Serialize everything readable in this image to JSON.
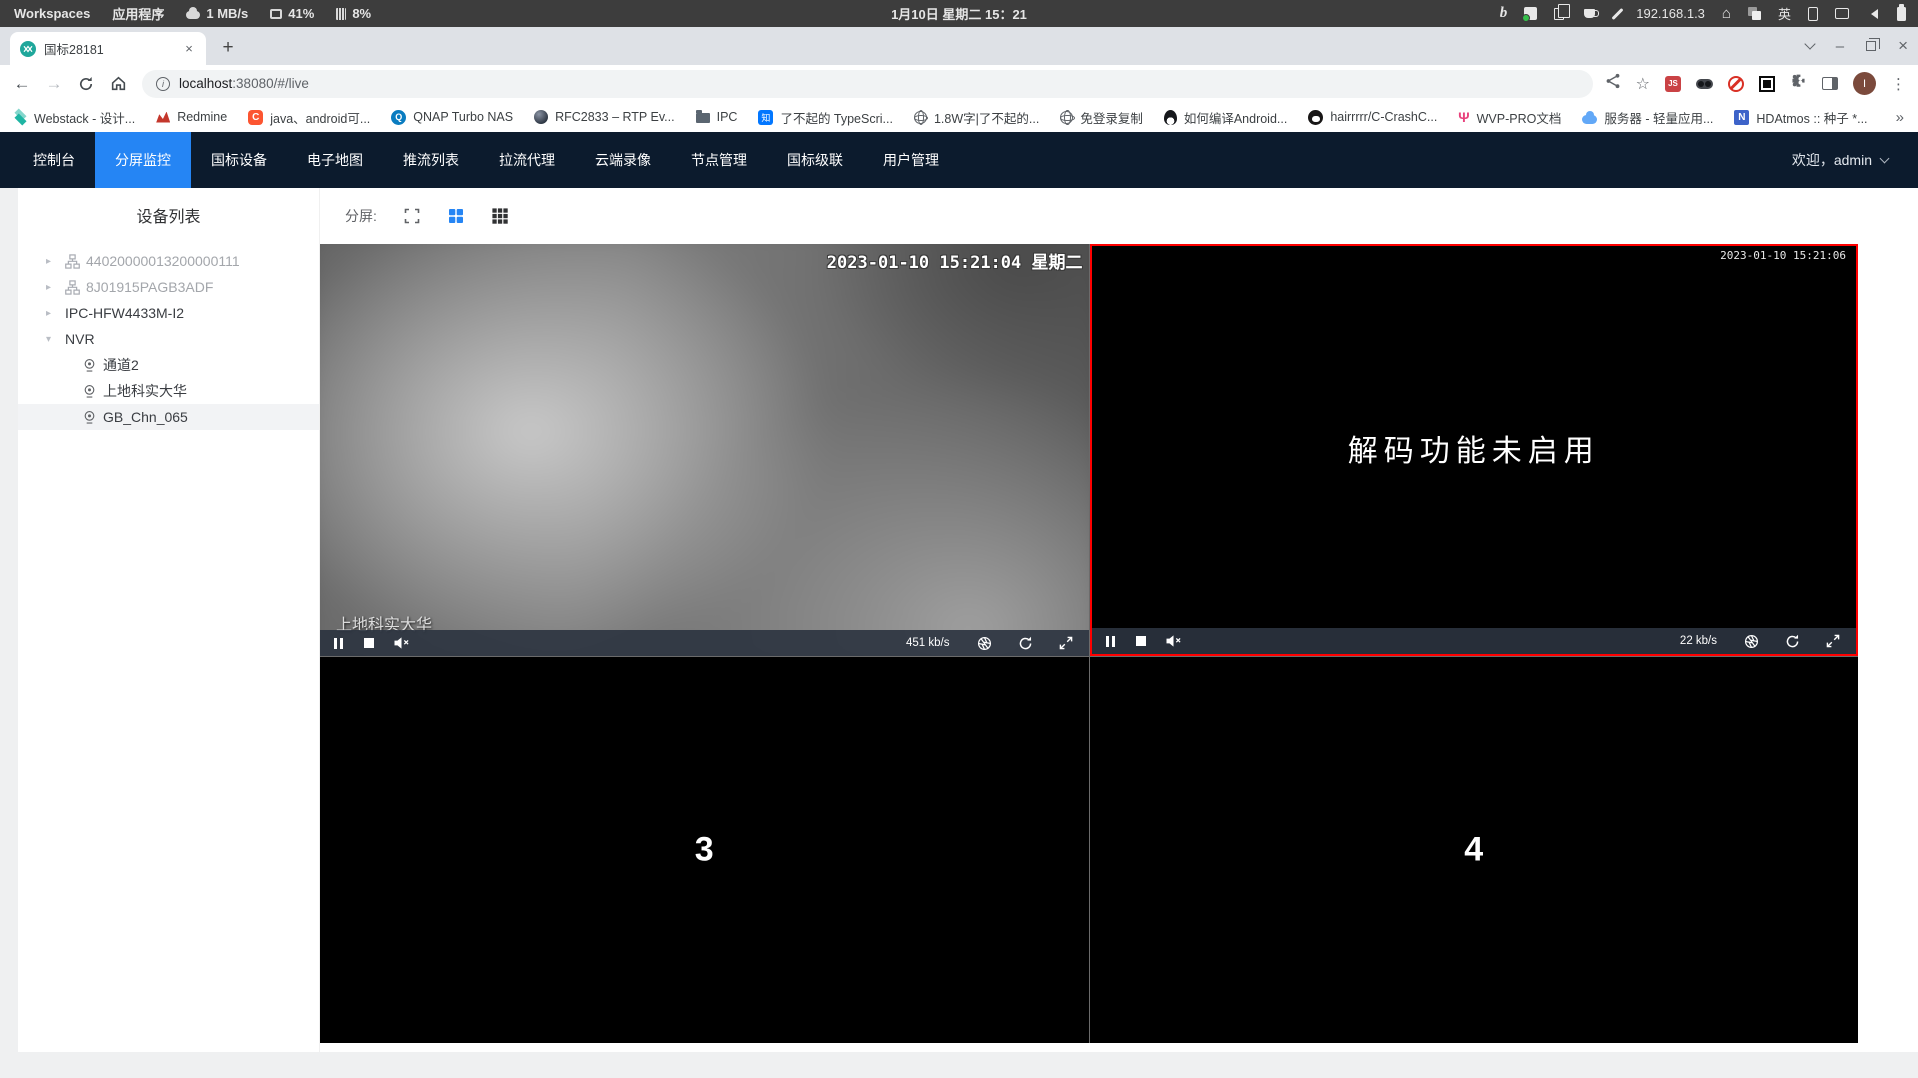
{
  "colors": {
    "nav_bg": "#0c1b2d",
    "nav_active": "#2585f4",
    "selected_cell_border": "#ff0000"
  },
  "system_bar": {
    "workspaces": "Workspaces",
    "applications": "应用程序",
    "net_speed": "1 MB/s",
    "cpu": "41%",
    "memory": "8%",
    "clock": "1月10日 星期二 15：21",
    "bing": "b",
    "ip": "192.168.1.3",
    "lang": "英"
  },
  "browser": {
    "tab_title": "国标28181",
    "url_host": "localhost",
    "url_rest": ":38080/#/live",
    "avatar": "I"
  },
  "glyphs": {
    "back": "←",
    "forward": "→",
    "star": "☆",
    "new_tab": "+",
    "close": "×",
    "kebab": "⋮",
    "overflow": "»",
    "collapsed": "▸",
    "expanded": "▾",
    "info": "i",
    "minimize": "–",
    "js": "JS",
    "home": "⌂"
  },
  "bookmarks": [
    {
      "icon": "webstack-icon",
      "label": "Webstack - 设计..."
    },
    {
      "icon": "redmine-icon",
      "label": "Redmine"
    },
    {
      "icon": "csdn-icon",
      "glyph": "C",
      "label": "java、android可..."
    },
    {
      "icon": "qnap-icon",
      "glyph": "Q",
      "label": "QNAP Turbo NAS"
    },
    {
      "icon": "sphere-icon",
      "label": "RFC2833 – RTP Ev..."
    },
    {
      "icon": "folder-icon",
      "label": "IPC"
    },
    {
      "icon": "zhihu-icon",
      "glyph": "知",
      "label": "了不起的 TypeScri..."
    },
    {
      "icon": "globe-icon",
      "label": "1.8W字|了不起的..."
    },
    {
      "icon": "globe-icon",
      "label": "免登录复制"
    },
    {
      "icon": "penguin-icon",
      "label": "如何编译Android..."
    },
    {
      "icon": "github-icon",
      "label": "hairrrrr/C-CrashC..."
    },
    {
      "icon": "wvp-icon",
      "glyph": "Ψ",
      "label": "WVP-PRO文档"
    },
    {
      "icon": "cloud-icon",
      "label": "服务器 - 轻量应用..."
    },
    {
      "icon": "hdatmos-icon",
      "glyph": "N",
      "label": "HDAtmos :: 种子 *..."
    }
  ],
  "nav": {
    "items": [
      "控制台",
      "分屏监控",
      "国标设备",
      "电子地图",
      "推流列表",
      "拉流代理",
      "云端录像",
      "节点管理",
      "国标级联",
      "用户管理"
    ],
    "active_index": 1,
    "welcome": "欢迎，admin"
  },
  "sidebar": {
    "title": "设备列表",
    "tree": [
      {
        "label": "44020000013200000111",
        "type": "device",
        "state": "offline"
      },
      {
        "label": "8J01915PAGB3ADF",
        "type": "device",
        "state": "offline"
      },
      {
        "label": "IPC-HFW4433M-I2",
        "type": "device",
        "state": "online"
      },
      {
        "label": "NVR",
        "type": "device",
        "state": "online",
        "expanded": true
      },
      {
        "label": "通道2",
        "type": "channel"
      },
      {
        "label": "上地科实大华",
        "type": "channel"
      },
      {
        "label": "GB_Chn_065",
        "type": "channel",
        "selected": true
      }
    ]
  },
  "split_toolbar": {
    "label": "分屏:"
  },
  "grid": {
    "cells": [
      {
        "index": "1",
        "state": "playing",
        "timestamp": "2023-01-10 15:21:04 星期二",
        "overlay_name": "上地科实大华",
        "bitrate": "451 kb/s"
      },
      {
        "index": "2",
        "state": "message",
        "selected": true,
        "timestamp": "2023-01-10 15:21:06",
        "message": "解码功能未启用",
        "bitrate": "22 kb/s"
      },
      {
        "index": "3",
        "state": "idle",
        "label": "3"
      },
      {
        "index": "4",
        "state": "idle",
        "label": "4"
      }
    ]
  }
}
